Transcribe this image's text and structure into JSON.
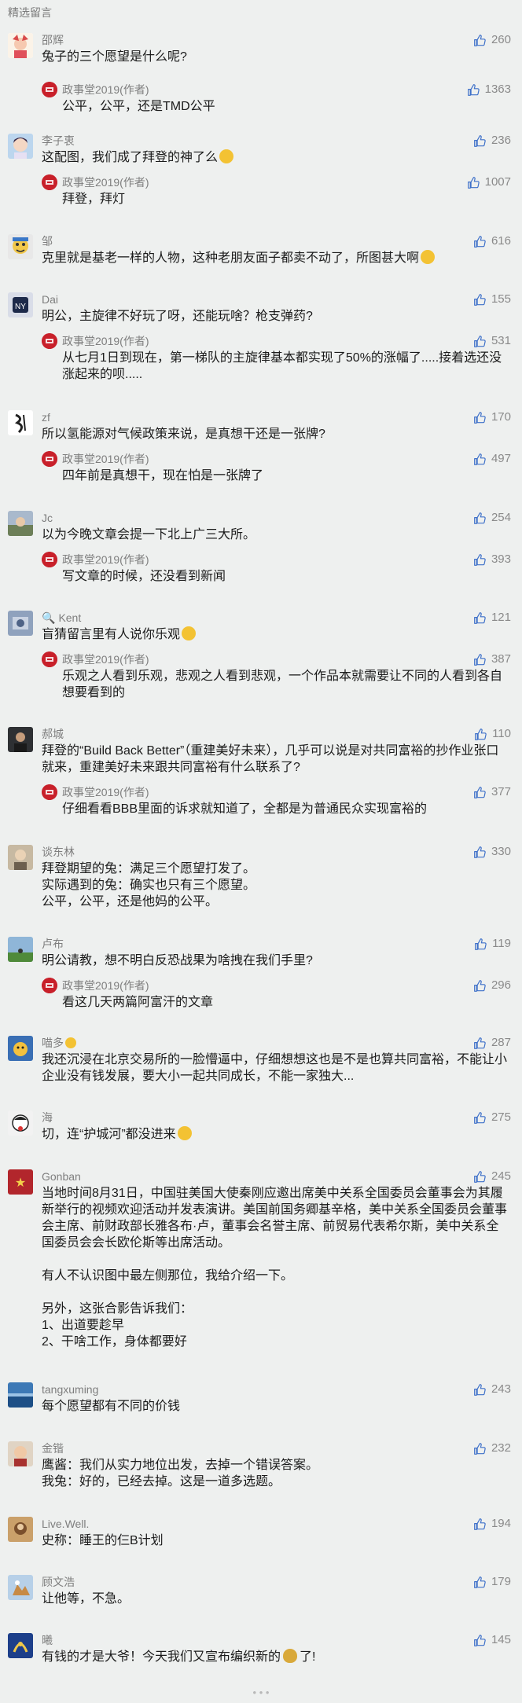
{
  "section_title": "精选留言",
  "author_badge": "(作者)",
  "comments": [
    {
      "name": "邵辉",
      "likes": "260",
      "text": "兔子的三个愿望是什么呢?",
      "reply": {
        "name": "政事堂2019",
        "likes": "1363",
        "text": "公平，公平，还是TMD公平"
      }
    },
    {
      "name": "李子衷",
      "likes": "236",
      "text": "这配图，我们成了拜登的神了么",
      "reply": {
        "name": "政事堂2019",
        "likes": "1007",
        "text": "拜登，拜灯"
      }
    },
    {
      "name": "邹",
      "likes": "616",
      "text": "克里就是基老一样的人物，这种老朋友面子都卖不动了，所图甚大啊"
    },
    {
      "name": "Dai",
      "likes": "155",
      "text": "明公，主旋律不好玩了呀，还能玩啥？枪支弹药?",
      "reply": {
        "name": "政事堂2019",
        "likes": "531",
        "text": "从七月1日到现在，第一梯队的主旋律基本都实现了50%的涨幅了.....接着选还没涨起来的呗....."
      }
    },
    {
      "name": "zf",
      "likes": "170",
      "text": "所以氢能源对气候政策来说，是真想干还是一张牌?",
      "reply": {
        "name": "政事堂2019",
        "likes": "497",
        "text": "四年前是真想干，现在怕是一张牌了"
      }
    },
    {
      "name": "Jc",
      "likes": "254",
      "text": "以为今晚文章会提一下北上广三大所。",
      "reply": {
        "name": "政事堂2019",
        "likes": "393",
        "text": "写文章的时候，还没看到新闻"
      }
    },
    {
      "name": "Kent",
      "likes": "121",
      "text": "盲猜留言里有人说你乐观",
      "reply": {
        "name": "政事堂2019",
        "likes": "387",
        "text": "乐观之人看到乐观，悲观之人看到悲观，一个作品本就需要让不同的人看到各自想要看到的"
      }
    },
    {
      "name": "郝城",
      "likes": "110",
      "text": "拜登的“Build Back Better”（重建美好未来），几乎可以说是对共同富裕的抄作业张口就来，重建美好未来跟共同富裕有什么联系了?",
      "reply": {
        "name": "政事堂2019",
        "likes": "377",
        "text": "仔细看看BBB里面的诉求就知道了，全都是为普通民众实现富裕的"
      }
    },
    {
      "name": "谈东林",
      "likes": "330",
      "text": "拜登期望的兔：满足三个愿望打发了。\n实际遇到的兔：确实也只有三个愿望。\n公平，公平，还是他妈的公平。"
    },
    {
      "name": "卢布",
      "likes": "119",
      "text": "明公请教，想不明白反恐战果为啥拽在我们手里?",
      "reply": {
        "name": "政事堂2019",
        "likes": "296",
        "text": "看这几天两篇阿富汗的文章"
      }
    },
    {
      "name": "喵多",
      "likes": "287",
      "text": "我还沉浸在北京交易所的一脸懵逼中，仔细想想这也是不是也算共同富裕，不能让小企业没有钱发展，要大小一起共同成长，不能一家独大..."
    },
    {
      "name": "海",
      "likes": "275",
      "text": "切，连“护城河”都没进来"
    },
    {
      "name": "Gonban",
      "likes": "245",
      "text": "当地时间8月31日，中国驻美国大使秦刚应邀出席美中关系全国委员会董事会为其履新举行的视频欢迎活动并发表演讲。美国前国务卿基辛格，美中关系全国委员会董事会主席、前财政部长雅各布·卢，董事会名誉主席、前贸易代表希尔斯，美中关系全国委员会会长欧伦斯等出席活动。\n\n有人不认识图中最左侧那位，我给介绍一下。\n\n另外，这张合影告诉我们：\n1、出道要趁早\n2、干啥工作，身体都要好"
    },
    {
      "name": "tangxuming",
      "likes": "243",
      "text": "每个愿望都有不同的价钱"
    },
    {
      "name": "金锴",
      "likes": "232",
      "text": "鹰酱：我们从实力地位出发，去掉一个错误答案。\n我兔：好的，已经去掉。这是一道多选题。"
    },
    {
      "name": "Live.Well.",
      "likes": "194",
      "text": "史称：睡王的仨B计划"
    },
    {
      "name": "顾文浩",
      "likes": "179",
      "text": "让他等，不急。"
    },
    {
      "name": "曦",
      "likes": "145",
      "text": "有钱的才是大爷！今天我们又宣布编织新的",
      "text_tail": "了!"
    }
  ],
  "colors": {
    "background": "#eef0ef",
    "name": "#7e7e7e",
    "text": "#1b1b1b",
    "reply_avatar": "#c8202a"
  },
  "icons": {
    "like": "thumb-up-icon",
    "author": "seal-avatar-icon"
  }
}
